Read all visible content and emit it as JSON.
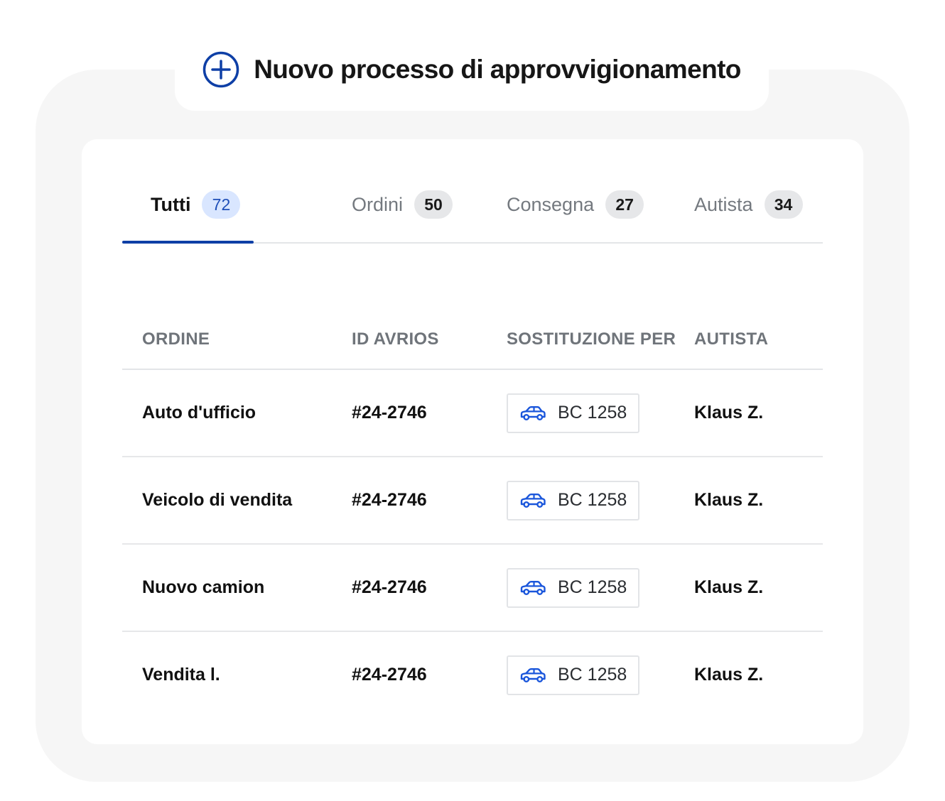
{
  "header": {
    "title": "Nuovo processo di approvvigionamento",
    "icon": "plus-circle-icon",
    "accent": "#0e3fa6"
  },
  "tabs": [
    {
      "label": "Tutti",
      "count": "72",
      "active": true
    },
    {
      "label": "Ordini",
      "count": "50",
      "active": false
    },
    {
      "label": "Consegna",
      "count": "27",
      "active": false
    },
    {
      "label": "Autista",
      "count": "34",
      "active": false
    }
  ],
  "table": {
    "columns": [
      "ORDINE",
      "ID AVRIOS",
      "SOSTITUZIONE PER",
      "AUTISTA"
    ],
    "rows": [
      {
        "order": "Auto d'ufficio",
        "id": "#24-2746",
        "vehicle": "BC 1258",
        "driver": "Klaus Z."
      },
      {
        "order": "Veicolo di vendita",
        "id": "#24-2746",
        "vehicle": "BC 1258",
        "driver": "Klaus Z."
      },
      {
        "order": "Nuovo camion",
        "id": "#24-2746",
        "vehicle": "BC 1258",
        "driver": "Klaus Z."
      },
      {
        "order": "Vendita l.",
        "id": "#24-2746",
        "vehicle": "BC 1258",
        "driver": "Klaus Z."
      }
    ],
    "vehicle_icon": "car-icon",
    "vehicle_icon_color": "#1a56db"
  }
}
